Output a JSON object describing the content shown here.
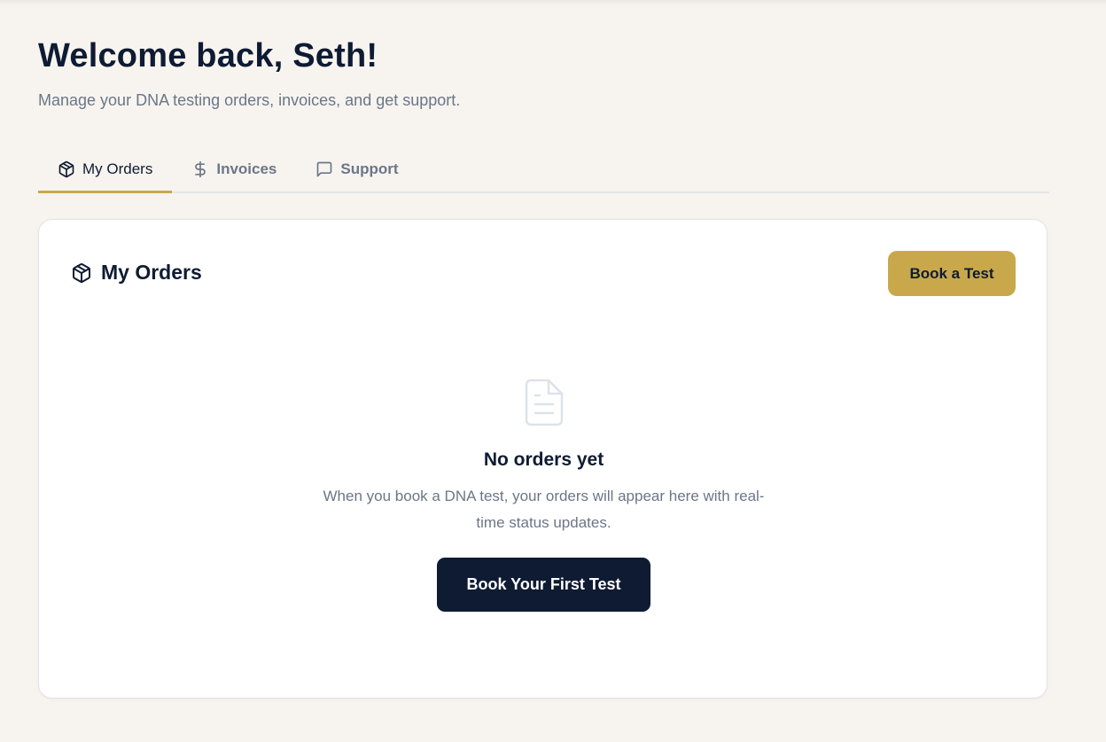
{
  "header": {
    "title": "Welcome back, Seth!",
    "subtitle": "Manage your DNA testing orders, invoices, and get support."
  },
  "tabs": [
    {
      "label": "My Orders",
      "icon": "package-icon",
      "active": true
    },
    {
      "label": "Invoices",
      "icon": "dollar-icon",
      "active": false
    },
    {
      "label": "Support",
      "icon": "message-icon",
      "active": false
    }
  ],
  "orders_card": {
    "title": "My Orders",
    "icon": "package-icon",
    "book_button_label": "Book a Test",
    "empty_state": {
      "icon": "document-icon",
      "title": "No orders yet",
      "description": "When you book a DNA test, your orders will appear here with real-time status updates.",
      "cta_label": "Book Your First Test"
    }
  },
  "colors": {
    "background": "#f7f4ef",
    "accent_gold": "#c9a84c",
    "navy": "#0f1b33",
    "muted_text": "#6b7688"
  }
}
